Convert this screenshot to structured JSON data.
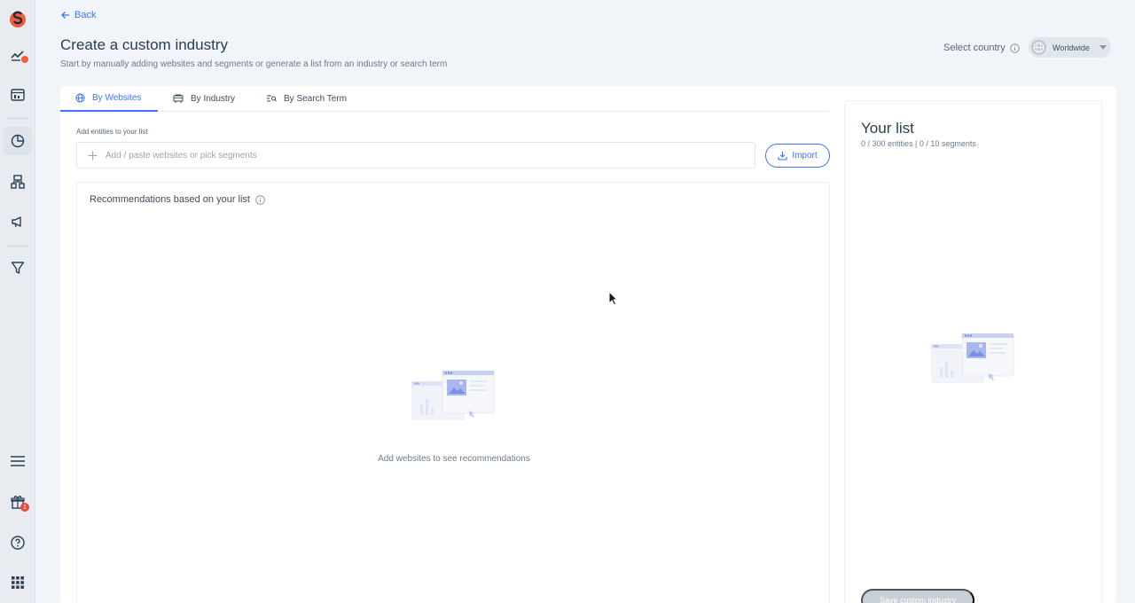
{
  "header": {
    "back_label": "Back",
    "title": "Create a custom industry",
    "subtitle": "Start by manually adding websites and segments or generate a list from an industry or search term",
    "country_label": "Select country",
    "country_value": "Worldwide"
  },
  "tabs": [
    {
      "label": "By Websites",
      "icon": "globe-icon",
      "active": true
    },
    {
      "label": "By Industry",
      "icon": "industry-icon",
      "active": false
    },
    {
      "label": "By Search Term",
      "icon": "search-term-icon",
      "active": false
    }
  ],
  "add_entities": {
    "label": "Add entities to your list",
    "placeholder": "Add / paste websites or pick segments",
    "import_label": "Import"
  },
  "recommendations": {
    "title": "Recommendations based on your list",
    "empty_text": "Add websites to see recommendations"
  },
  "your_list": {
    "title": "Your list",
    "count": "0 / 300 entities | 0 / 10 segments",
    "save_label": "Save custom industry"
  },
  "sidebar": {
    "items": [
      {
        "name": "brand-logo-icon"
      },
      {
        "name": "trends-icon"
      },
      {
        "name": "dashboard-icon"
      },
      {
        "name": "pie-chart-icon"
      },
      {
        "name": "hierarchy-icon"
      },
      {
        "name": "megaphone-icon"
      },
      {
        "name": "funnel-icon"
      },
      {
        "name": "menu-icon"
      },
      {
        "name": "gift-icon"
      },
      {
        "name": "help-icon"
      },
      {
        "name": "apps-grid-icon"
      }
    ],
    "gift_badge": "1"
  },
  "colors": {
    "accent": "#3e74fe",
    "brand": "#f15d3a",
    "background": "#f1f4f9"
  }
}
